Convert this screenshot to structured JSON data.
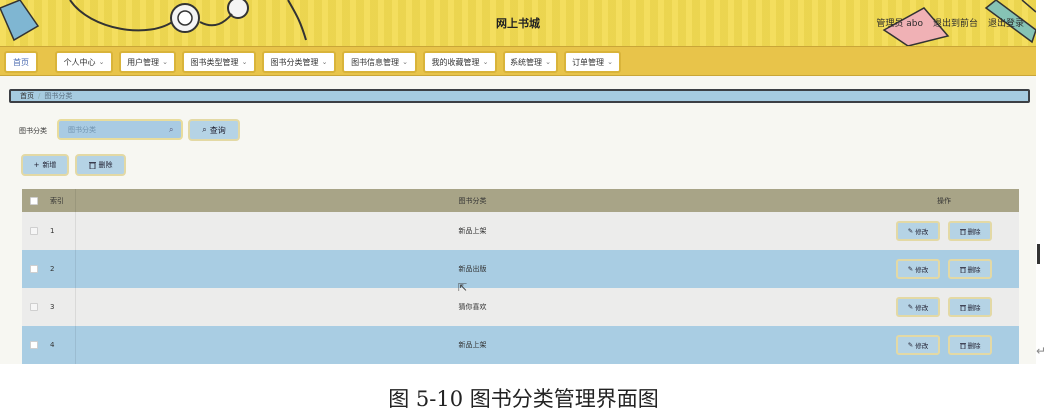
{
  "header": {
    "title": "网上书城",
    "user_text": "管理员 abo",
    "to_front": "退出到前台",
    "logout": "退出登录"
  },
  "nav": {
    "items": [
      {
        "label": "首页",
        "dropdown": false
      },
      {
        "label": "个人中心",
        "dropdown": true
      },
      {
        "label": "用户管理",
        "dropdown": true
      },
      {
        "label": "图书类型管理",
        "dropdown": true
      },
      {
        "label": "图书分类管理",
        "dropdown": true
      },
      {
        "label": "图书信息管理",
        "dropdown": true
      },
      {
        "label": "我的收藏管理",
        "dropdown": true
      },
      {
        "label": "系统管理",
        "dropdown": true
      },
      {
        "label": "订单管理",
        "dropdown": true
      }
    ]
  },
  "breadcrumb": {
    "home": "首页",
    "separator": "/",
    "current": "图书分类"
  },
  "search": {
    "label": "图书分类",
    "placeholder": "图书分类",
    "query_button": "查询"
  },
  "actions": {
    "add": "新增",
    "delete": "删除"
  },
  "table": {
    "headers": {
      "index": "索引",
      "name": "图书分类",
      "ops": "操作"
    },
    "rows": [
      {
        "index": "1",
        "name": "新品上架"
      },
      {
        "index": "2",
        "name": "新品出版"
      },
      {
        "index": "3",
        "name": "猜你喜欢"
      },
      {
        "index": "4",
        "name": "新品上架"
      }
    ],
    "edit_label": "修改",
    "delete_label": "删除"
  },
  "caption": "图 5-10 图书分类管理界面图",
  "colors": {
    "header_bg": "#f3dc52",
    "nav_bg": "#e8c44a",
    "accent_blue": "#a9cde3",
    "table_header": "#a8a487"
  },
  "icons": {
    "search": "search-icon",
    "plus": "plus-icon",
    "trash": "trash-icon",
    "edit": "edit-icon",
    "chevron": "chevron-down-icon"
  }
}
